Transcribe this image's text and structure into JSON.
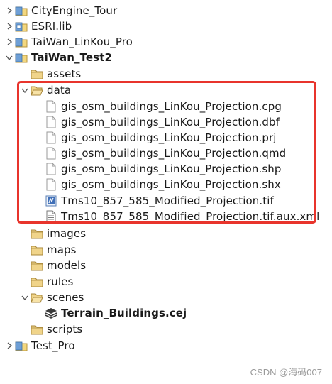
{
  "tree": {
    "projects": [
      {
        "label": "CityEngine_Tour"
      },
      {
        "label": "ESRI.lib"
      },
      {
        "label": "TaiWan_LinKou_Pro"
      },
      {
        "label": "TaiWan_Test2"
      },
      {
        "label": "Test_Pro"
      }
    ],
    "folders": {
      "assets": "assets",
      "data": "data",
      "images": "images",
      "maps": "maps",
      "models": "models",
      "rules": "rules",
      "scenes": "scenes",
      "scripts": "scripts"
    },
    "data_files": [
      "gis_osm_buildings_LinKou_Projection.cpg",
      "gis_osm_buildings_LinKou_Projection.dbf",
      "gis_osm_buildings_LinKou_Projection.prj",
      "gis_osm_buildings_LinKou_Projection.qmd",
      "gis_osm_buildings_LinKou_Projection.shp",
      "gis_osm_buildings_LinKou_Projection.shx",
      "Tms10_857_585_Modified_Projection.tif",
      "Tms10_857_585_Modified_Projection.tif.aux.xml"
    ],
    "scene_file": "Terrain_Buildings.cej"
  },
  "watermark": "CSDN @海码007",
  "colors": {
    "highlight": "#e8342c",
    "folder": "#e7c36a",
    "chevron": "#555555"
  }
}
